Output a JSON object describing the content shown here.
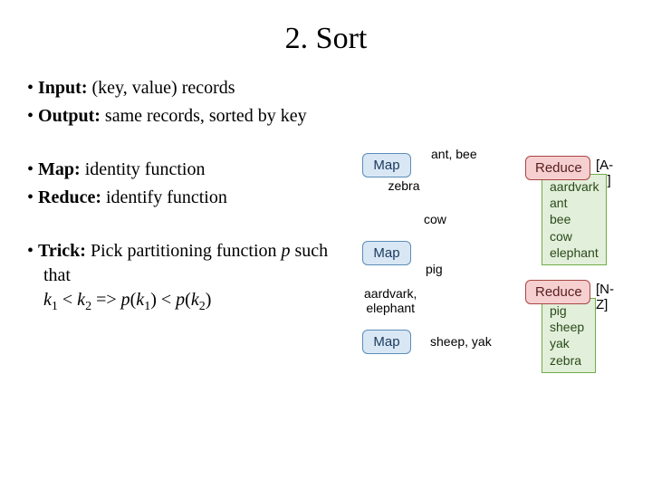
{
  "title": "2. Sort",
  "bullets": {
    "input_label": "Input:",
    "input_text": " (key, value) records",
    "output_label": "Output:",
    "output_text": " same records, sorted by key",
    "map_label": "Map:",
    "map_text": " identity function",
    "reduce_label": "Reduce:",
    "reduce_text": " identify function",
    "trick_label": "Trick:",
    "trick_text_a": " Pick partitioning function ",
    "trick_p": "p",
    "trick_text_b": " such that ",
    "trick_k1": "k",
    "trick_s1": "1",
    "trick_lt1": " < ",
    "trick_k2": "k",
    "trick_s2": "2",
    "trick_imp": " => ",
    "trick_pk1a": "p",
    "trick_op1": "(",
    "trick_k3": "k",
    "trick_s3": "1",
    "trick_cp1": ")",
    "trick_lt2": " < ",
    "trick_pk2a": "p",
    "trick_op2": "(",
    "trick_k4": "k",
    "trick_s4": "2",
    "trick_cp2": ")"
  },
  "diagram": {
    "map": "Map",
    "reduce": "Reduce",
    "edge_antbee": "ant, bee",
    "edge_zebra": "zebra",
    "edge_cow": "cow",
    "edge_pig": "pig",
    "edge_aardvark": "aardvark,\nelephant",
    "edge_sheepyak": "sheep, yak",
    "range_am": "[A-M]",
    "range_nz": "[N-Z]",
    "out1_l1": "aardvark",
    "out1_l2": "ant",
    "out1_l3": "bee",
    "out1_l4": "cow",
    "out1_l5": "elephant",
    "out2_l1": "pig",
    "out2_l2": "sheep",
    "out2_l3": "yak",
    "out2_l4": "zebra"
  }
}
